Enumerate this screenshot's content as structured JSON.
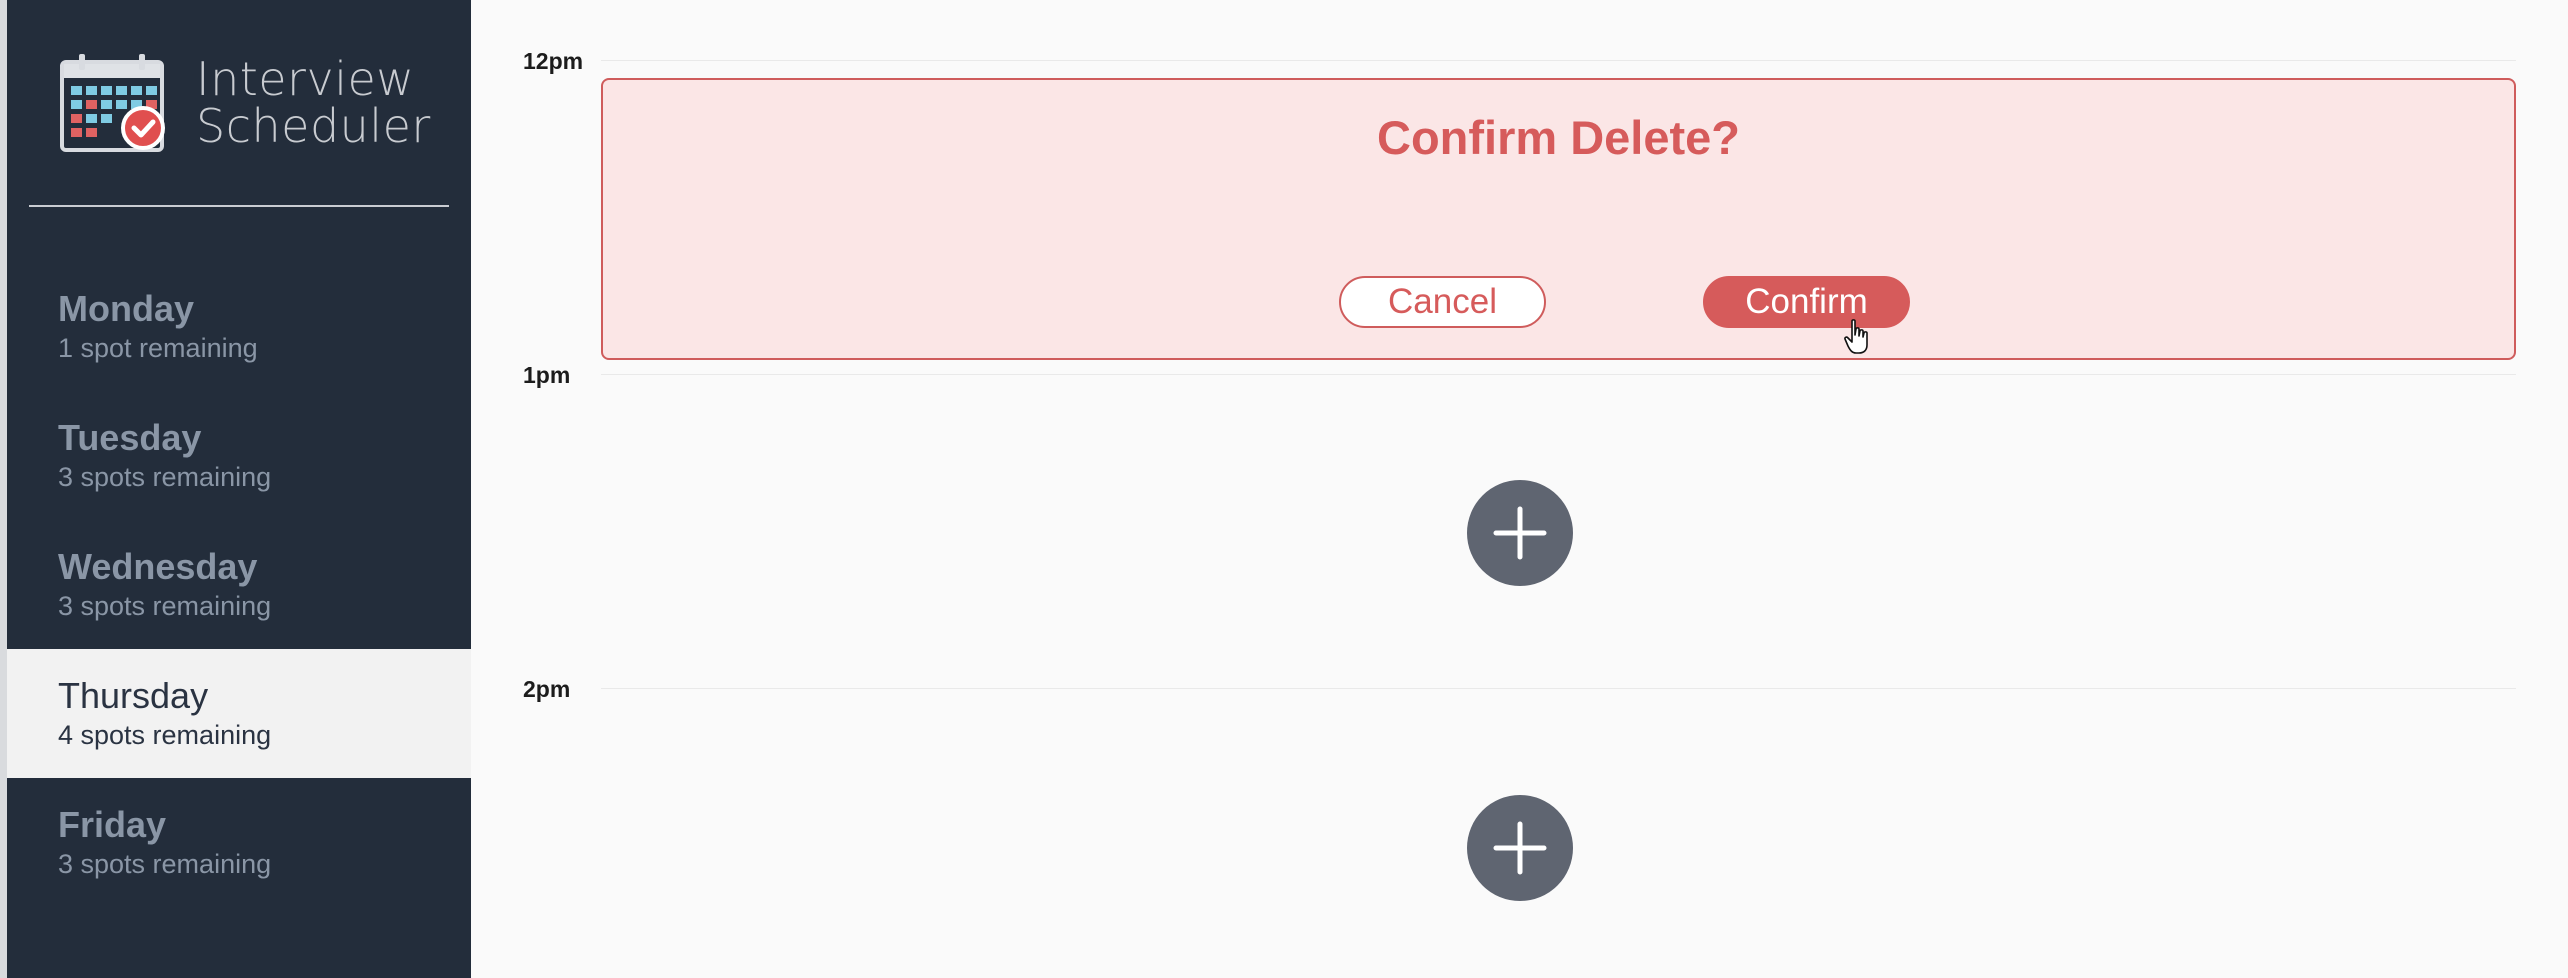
{
  "app": {
    "title_line1": "Interview",
    "title_line2": "Scheduler",
    "logo_icon": "calendar-check-icon"
  },
  "sidebar": {
    "days": [
      {
        "name": "Monday",
        "spots": "1 spot remaining",
        "selected": false
      },
      {
        "name": "Tuesday",
        "spots": "3 spots remaining",
        "selected": false
      },
      {
        "name": "Wednesday",
        "spots": "3 spots remaining",
        "selected": false
      },
      {
        "name": "Thursday",
        "spots": "4 spots remaining",
        "selected": true
      },
      {
        "name": "Friday",
        "spots": "3 spots remaining",
        "selected": false
      }
    ]
  },
  "schedule": {
    "times": [
      "12pm",
      "1pm",
      "2pm"
    ],
    "confirm": {
      "message": "Confirm Delete?",
      "cancel_label": "Cancel",
      "confirm_label": "Confirm"
    },
    "add_icon": "plus-icon"
  },
  "colors": {
    "sidebar_bg": "#232d3b",
    "danger": "#d65b5b",
    "danger_bg": "#fbe6e6",
    "add_button": "#5f6571",
    "selected_day_bg": "#f2f2f2"
  }
}
